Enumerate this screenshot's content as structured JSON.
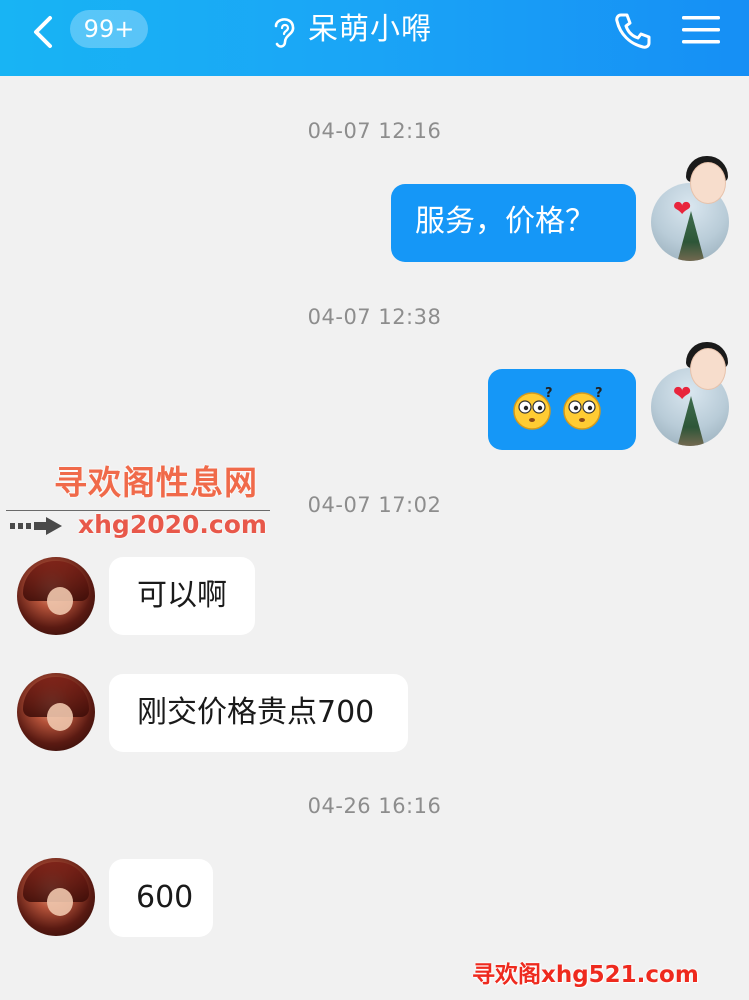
{
  "header": {
    "unread_badge": "99+",
    "title": "呆萌小嘚"
  },
  "messages": [
    {
      "timestamp": "04-07 12:16",
      "direction": "out",
      "text": "服务，价格？"
    },
    {
      "timestamp": "04-07 12:38",
      "direction": "out",
      "text": "",
      "stickers": [
        "confused-emoji",
        "confused-emoji"
      ]
    },
    {
      "timestamp": "04-07 17:02",
      "direction": "in",
      "text": "可以啊"
    },
    {
      "timestamp": "",
      "direction": "in",
      "text": "刚交价格贵点700"
    },
    {
      "timestamp": "04-26 16:16",
      "direction": "in",
      "text": "600"
    }
  ],
  "watermarks": {
    "site_name": "寻欢阁性息网",
    "site_url": "xhg2020.com",
    "bottom": "寻欢阁xhg521.com"
  },
  "colors": {
    "header_accent": "#18b4f4",
    "outgoing_bubble": "#1597f7",
    "incoming_bubble": "#ffffff",
    "background": "#f1f1f1"
  }
}
